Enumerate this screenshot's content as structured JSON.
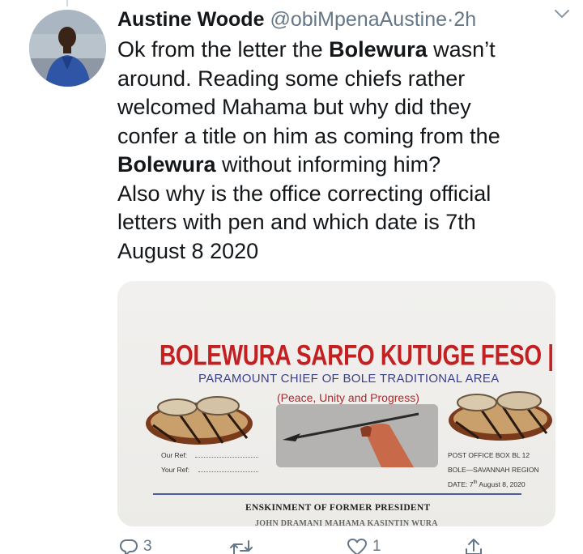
{
  "tweet": {
    "author_name": "Austine Woode",
    "handle": "@obiMpenaAustine",
    "separator": "·",
    "time": "2h",
    "body": {
      "line1_pre": "Ok from the letter the ",
      "line1_bold": "Bolewura",
      "line1_post": " wasn’t",
      "line2": "around. Reading some chiefs rather",
      "line3": "welcomed Mahama but why did they",
      "line4": "confer a title on him as coming from the",
      "line5_bold": "Bolewura",
      "line5_post": " without informing him?",
      "line6": "Also why is the office correcting official",
      "line7": "letters with pen and which date is 7th",
      "line8": "August 8 2020"
    },
    "icons": {
      "menu": "chevron-down-icon",
      "avatar": "avatar"
    }
  },
  "media": {
    "letterhead_title": "BOLEWURA SARFO KUTUGE FESO |",
    "letterhead_subtitle": "PARAMOUNT CHIEF OF BOLE TRADITIONAL AREA",
    "motto": "(Peace, Unity and Progress)",
    "our_ref": "Our Ref:",
    "your_ref": "Your Ref:",
    "po_box": "POST OFFICE BOX BL 12",
    "region": "BOLE—SAVANNAH REGION",
    "date_prefix": "DATE: 7",
    "date_sup": "th",
    "date_suffix": " August 8, 2020",
    "heading": "ENSKINMENT OF FORMER PRESIDENT",
    "cut_line": "JOHN DRAMANI MAHAMA KASINTIN WURA",
    "colors": {
      "title": "#c32121",
      "subtitle": "#3b3f86",
      "rule": "#4a5ea0"
    }
  },
  "actions": {
    "reply_count": "3",
    "retweet_count": "",
    "like_count": "1",
    "share_count": "",
    "icons": [
      "reply-icon",
      "retweet-icon",
      "like-icon",
      "share-icon"
    ],
    "color": "#657786"
  }
}
